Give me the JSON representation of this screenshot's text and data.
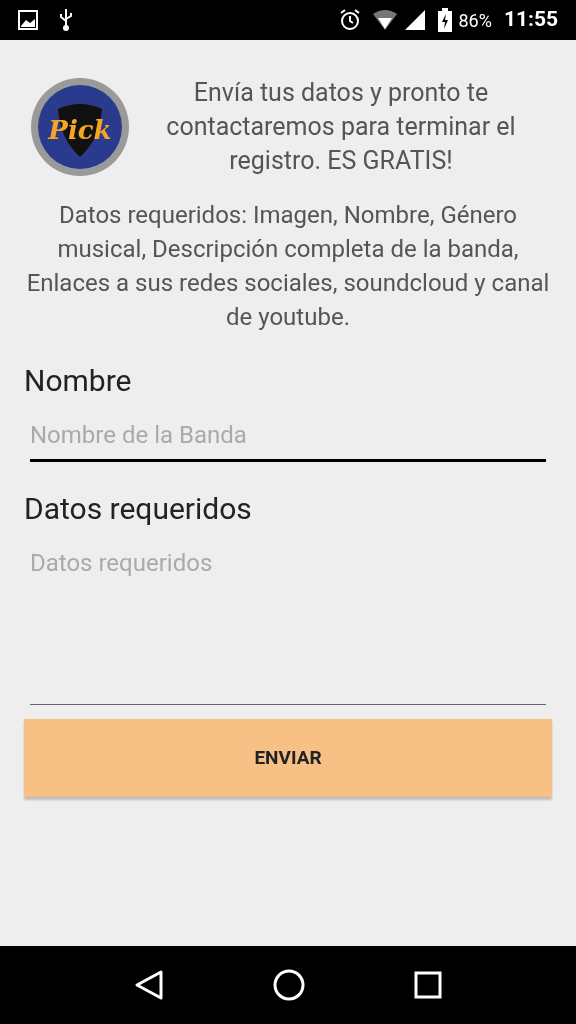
{
  "status_bar": {
    "battery": "86%",
    "time": "11:55"
  },
  "logo": {
    "text": "Pick"
  },
  "intro": "Envía tus datos y pronto te contactaremos para terminar el registro. ES GRATIS!",
  "requirements": "Datos requeridos: Imagen, Nombre, Género musical, Descripción completa de la banda, Enlaces a sus redes sociales, soundcloud y canal de youtube.",
  "fields": [
    {
      "kind": "single",
      "label": "Nombre",
      "placeholder": "Nombre de la Banda",
      "focused": true
    },
    {
      "kind": "multi",
      "label": "Datos requeridos",
      "placeholder": "Datos requeridos",
      "focused": false
    }
  ],
  "submit_button": "ENVIAR"
}
